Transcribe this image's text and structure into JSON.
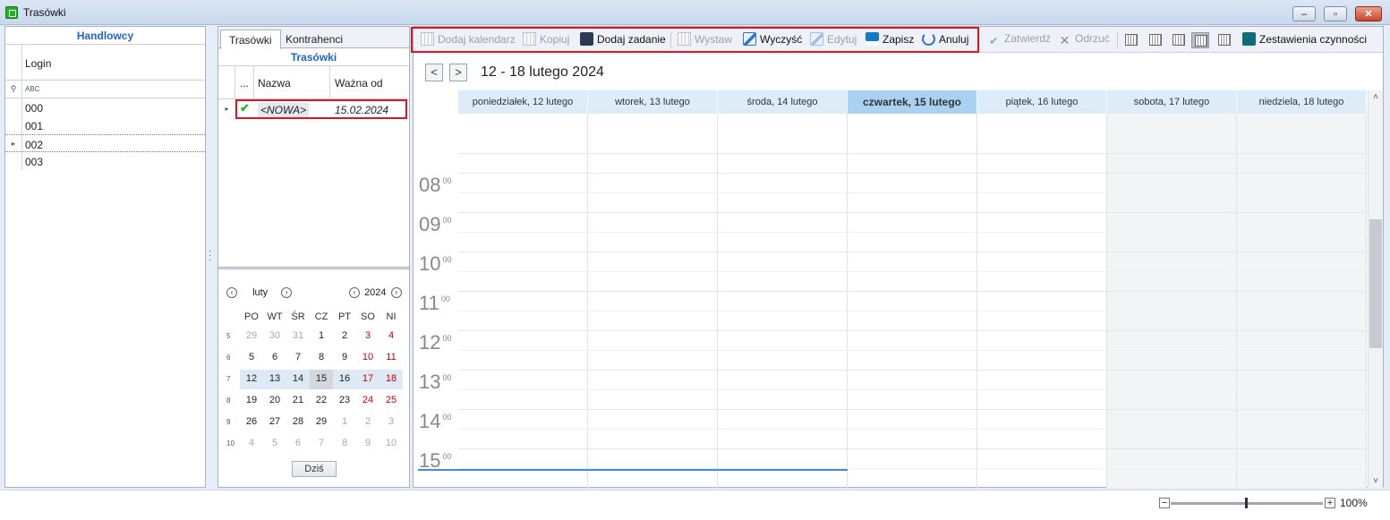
{
  "window": {
    "title": "Trasówki"
  },
  "left": {
    "header": "Handlowcy",
    "column": "Login",
    "filter_glyph": "ABC",
    "rows": [
      "000",
      "001",
      "002",
      "003"
    ],
    "selected_index": 2
  },
  "middle": {
    "tabs": [
      "Trasówki",
      "Kontrahenci"
    ],
    "grid_title": "Trasówki",
    "col_dots": "...",
    "col_name": "Nazwa",
    "col_date": "Ważna od",
    "row": {
      "name": "<NOWA>",
      "date": "15.02.2024"
    }
  },
  "minical": {
    "month": "luty",
    "year": "2024",
    "dows": [
      "PO",
      "WT",
      "ŚR",
      "CZ",
      "PT",
      "SO",
      "NI"
    ],
    "weeks": [
      {
        "w": "5",
        "days": [
          "29",
          "30",
          "31",
          "1",
          "2",
          "3",
          "4"
        ],
        "other": [
          0,
          1,
          2
        ]
      },
      {
        "w": "6",
        "days": [
          "5",
          "6",
          "7",
          "8",
          "9",
          "10",
          "11"
        ],
        "other": []
      },
      {
        "w": "7",
        "days": [
          "12",
          "13",
          "14",
          "15",
          "16",
          "17",
          "18"
        ],
        "other": []
      },
      {
        "w": "8",
        "days": [
          "19",
          "20",
          "21",
          "22",
          "23",
          "24",
          "25"
        ],
        "other": []
      },
      {
        "w": "9",
        "days": [
          "26",
          "27",
          "28",
          "29",
          "1",
          "2",
          "3"
        ],
        "other": [
          4,
          5,
          6
        ]
      },
      {
        "w": "10",
        "days": [
          "4",
          "5",
          "6",
          "7",
          "8",
          "9",
          "10"
        ],
        "other": [
          0,
          1,
          2,
          3,
          4,
          5,
          6
        ]
      }
    ],
    "selected_week": 2,
    "today_col": 3,
    "today_button": "Dziś"
  },
  "toolbar": {
    "add_calendar": "Dodaj kalendarz",
    "copy": "Kopiuj",
    "add_task": "Dodaj zadanie",
    "issue": "Wystaw",
    "clear": "Wyczyść",
    "edit": "Edytuj",
    "save": "Zapisz",
    "cancel": "Anuluj",
    "approve": "Zatwierdź",
    "reject": "Odrzuć",
    "summary": "Zestawienia czynności"
  },
  "calendar": {
    "range": "12 - 18 lutego 2024",
    "prev": "<",
    "next": ">",
    "days": [
      "poniedziałek, 12 lutego",
      "wtorek, 13 lutego",
      "środa, 14 lutego",
      "czwartek, 15 lutego",
      "piątek, 16 lutego",
      "sobota, 17 lutego",
      "niedziela, 18 lutego"
    ],
    "today_index": 3,
    "hours": [
      "08",
      "09",
      "10",
      "11",
      "12",
      "13",
      "14",
      "15"
    ],
    "minutes": "00"
  },
  "zoom": {
    "value": "100%",
    "minus": "−",
    "plus": "+"
  }
}
